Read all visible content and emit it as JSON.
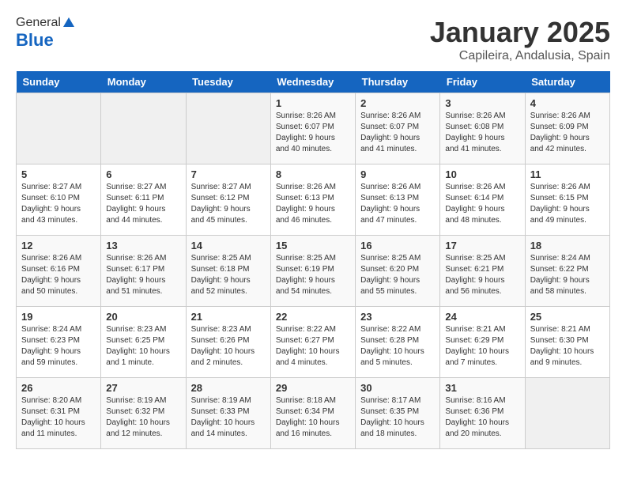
{
  "header": {
    "logo_general": "General",
    "logo_blue": "Blue",
    "month": "January 2025",
    "location": "Capileira, Andalusia, Spain"
  },
  "weekdays": [
    "Sunday",
    "Monday",
    "Tuesday",
    "Wednesday",
    "Thursday",
    "Friday",
    "Saturday"
  ],
  "weeks": [
    [
      {
        "day": "",
        "info": ""
      },
      {
        "day": "",
        "info": ""
      },
      {
        "day": "",
        "info": ""
      },
      {
        "day": "1",
        "info": "Sunrise: 8:26 AM\nSunset: 6:07 PM\nDaylight: 9 hours\nand 40 minutes."
      },
      {
        "day": "2",
        "info": "Sunrise: 8:26 AM\nSunset: 6:07 PM\nDaylight: 9 hours\nand 41 minutes."
      },
      {
        "day": "3",
        "info": "Sunrise: 8:26 AM\nSunset: 6:08 PM\nDaylight: 9 hours\nand 41 minutes."
      },
      {
        "day": "4",
        "info": "Sunrise: 8:26 AM\nSunset: 6:09 PM\nDaylight: 9 hours\nand 42 minutes."
      }
    ],
    [
      {
        "day": "5",
        "info": "Sunrise: 8:27 AM\nSunset: 6:10 PM\nDaylight: 9 hours\nand 43 minutes."
      },
      {
        "day": "6",
        "info": "Sunrise: 8:27 AM\nSunset: 6:11 PM\nDaylight: 9 hours\nand 44 minutes."
      },
      {
        "day": "7",
        "info": "Sunrise: 8:27 AM\nSunset: 6:12 PM\nDaylight: 9 hours\nand 45 minutes."
      },
      {
        "day": "8",
        "info": "Sunrise: 8:26 AM\nSunset: 6:13 PM\nDaylight: 9 hours\nand 46 minutes."
      },
      {
        "day": "9",
        "info": "Sunrise: 8:26 AM\nSunset: 6:13 PM\nDaylight: 9 hours\nand 47 minutes."
      },
      {
        "day": "10",
        "info": "Sunrise: 8:26 AM\nSunset: 6:14 PM\nDaylight: 9 hours\nand 48 minutes."
      },
      {
        "day": "11",
        "info": "Sunrise: 8:26 AM\nSunset: 6:15 PM\nDaylight: 9 hours\nand 49 minutes."
      }
    ],
    [
      {
        "day": "12",
        "info": "Sunrise: 8:26 AM\nSunset: 6:16 PM\nDaylight: 9 hours\nand 50 minutes."
      },
      {
        "day": "13",
        "info": "Sunrise: 8:26 AM\nSunset: 6:17 PM\nDaylight: 9 hours\nand 51 minutes."
      },
      {
        "day": "14",
        "info": "Sunrise: 8:25 AM\nSunset: 6:18 PM\nDaylight: 9 hours\nand 52 minutes."
      },
      {
        "day": "15",
        "info": "Sunrise: 8:25 AM\nSunset: 6:19 PM\nDaylight: 9 hours\nand 54 minutes."
      },
      {
        "day": "16",
        "info": "Sunrise: 8:25 AM\nSunset: 6:20 PM\nDaylight: 9 hours\nand 55 minutes."
      },
      {
        "day": "17",
        "info": "Sunrise: 8:25 AM\nSunset: 6:21 PM\nDaylight: 9 hours\nand 56 minutes."
      },
      {
        "day": "18",
        "info": "Sunrise: 8:24 AM\nSunset: 6:22 PM\nDaylight: 9 hours\nand 58 minutes."
      }
    ],
    [
      {
        "day": "19",
        "info": "Sunrise: 8:24 AM\nSunset: 6:23 PM\nDaylight: 9 hours\nand 59 minutes."
      },
      {
        "day": "20",
        "info": "Sunrise: 8:23 AM\nSunset: 6:25 PM\nDaylight: 10 hours\nand 1 minute."
      },
      {
        "day": "21",
        "info": "Sunrise: 8:23 AM\nSunset: 6:26 PM\nDaylight: 10 hours\nand 2 minutes."
      },
      {
        "day": "22",
        "info": "Sunrise: 8:22 AM\nSunset: 6:27 PM\nDaylight: 10 hours\nand 4 minutes."
      },
      {
        "day": "23",
        "info": "Sunrise: 8:22 AM\nSunset: 6:28 PM\nDaylight: 10 hours\nand 5 minutes."
      },
      {
        "day": "24",
        "info": "Sunrise: 8:21 AM\nSunset: 6:29 PM\nDaylight: 10 hours\nand 7 minutes."
      },
      {
        "day": "25",
        "info": "Sunrise: 8:21 AM\nSunset: 6:30 PM\nDaylight: 10 hours\nand 9 minutes."
      }
    ],
    [
      {
        "day": "26",
        "info": "Sunrise: 8:20 AM\nSunset: 6:31 PM\nDaylight: 10 hours\nand 11 minutes."
      },
      {
        "day": "27",
        "info": "Sunrise: 8:19 AM\nSunset: 6:32 PM\nDaylight: 10 hours\nand 12 minutes."
      },
      {
        "day": "28",
        "info": "Sunrise: 8:19 AM\nSunset: 6:33 PM\nDaylight: 10 hours\nand 14 minutes."
      },
      {
        "day": "29",
        "info": "Sunrise: 8:18 AM\nSunset: 6:34 PM\nDaylight: 10 hours\nand 16 minutes."
      },
      {
        "day": "30",
        "info": "Sunrise: 8:17 AM\nSunset: 6:35 PM\nDaylight: 10 hours\nand 18 minutes."
      },
      {
        "day": "31",
        "info": "Sunrise: 8:16 AM\nSunset: 6:36 PM\nDaylight: 10 hours\nand 20 minutes."
      },
      {
        "day": "",
        "info": ""
      }
    ]
  ]
}
